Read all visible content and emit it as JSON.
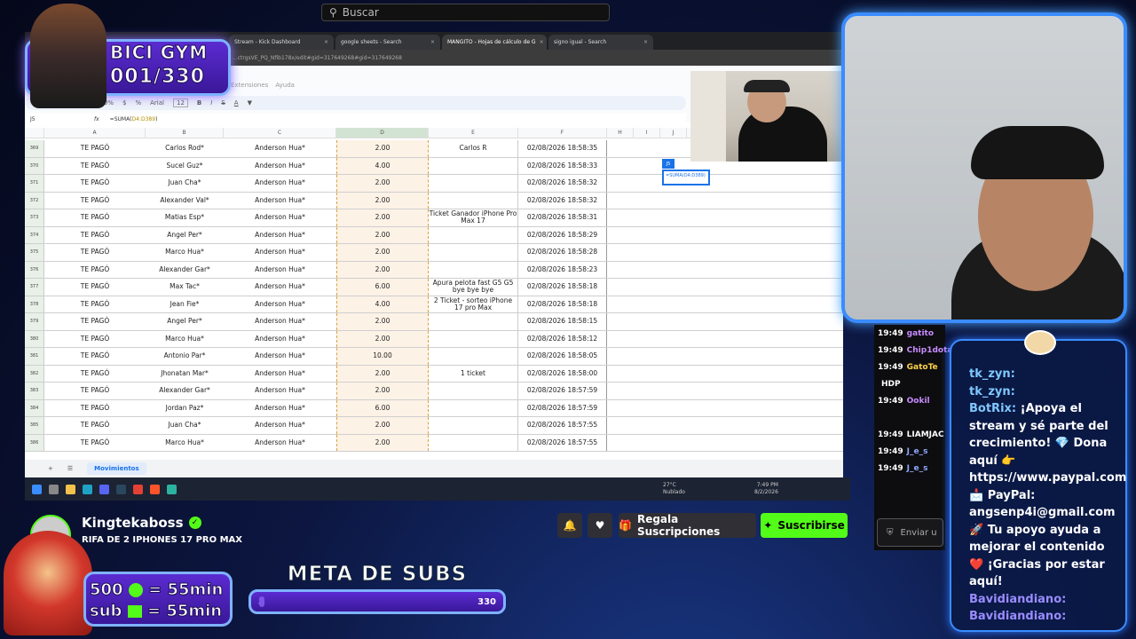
{
  "search": {
    "placeholder": "Buscar"
  },
  "browser": {
    "tabs": [
      {
        "label": "Stream - Kick Dashboard",
        "active": false
      },
      {
        "label": "google sheets - Search",
        "active": false
      },
      {
        "label": "MANGITO - Hojas de cálculo de G",
        "active": true
      },
      {
        "label": "signo igual - Search",
        "active": false
      }
    ],
    "url": "...ctrgsVE_PQ_Nfib178x/edit#gid=317649268#gid=317649268"
  },
  "sheet": {
    "menu": [
      "Extensiones",
      "Ayuda"
    ],
    "toolbar": {
      "zoom": "100%",
      "font": "Arial",
      "size": "12"
    },
    "cell_ref": "J5",
    "formula": "=SUMA(D4:D389)",
    "formula_fn": "=SUMA(",
    "formula_range": "D4:D389",
    "formula_close": ")",
    "columns": [
      "A",
      "B",
      "C",
      "D",
      "E",
      "F",
      "H",
      "I",
      "J"
    ],
    "rows": [
      {
        "n": "369",
        "a": "TE PAGÓ",
        "b": "Carlos Rod*",
        "c": "Anderson Hua*",
        "d": "2.00",
        "e": "Carlos R",
        "f": "02/08/2026 18:58:35"
      },
      {
        "n": "370",
        "a": "TE PAGÓ",
        "b": "Sucel Guz*",
        "c": "Anderson Hua*",
        "d": "4.00",
        "e": "",
        "f": "02/08/2026 18:58:33"
      },
      {
        "n": "371",
        "a": "TE PAGÓ",
        "b": "Juan Cha*",
        "c": "Anderson Hua*",
        "d": "2.00",
        "e": "",
        "f": "02/08/2026 18:58:32"
      },
      {
        "n": "372",
        "a": "TE PAGÓ",
        "b": "Alexander Val*",
        "c": "Anderson Hua*",
        "d": "2.00",
        "e": "",
        "f": "02/08/2026 18:58:32"
      },
      {
        "n": "373",
        "a": "TE PAGÓ",
        "b": "Matias Esp*",
        "c": "Anderson Hua*",
        "d": "2.00",
        "e": "Ticket Ganador iPhone Pro Max 17",
        "f": "02/08/2026 18:58:31"
      },
      {
        "n": "374",
        "a": "TE PAGÓ",
        "b": "Angel Per*",
        "c": "Anderson Hua*",
        "d": "2.00",
        "e": "",
        "f": "02/08/2026 18:58:29"
      },
      {
        "n": "375",
        "a": "TE PAGÓ",
        "b": "Marco Hua*",
        "c": "Anderson Hua*",
        "d": "2.00",
        "e": "",
        "f": "02/08/2026 18:58:28"
      },
      {
        "n": "376",
        "a": "TE PAGÓ",
        "b": "Alexander Gar*",
        "c": "Anderson Hua*",
        "d": "2.00",
        "e": "",
        "f": "02/08/2026 18:58:23"
      },
      {
        "n": "377",
        "a": "TE PAGÓ",
        "b": "Max Tac*",
        "c": "Anderson Hua*",
        "d": "6.00",
        "e": "Apura pelota fast G5 G5 bye bye bye",
        "f": "02/08/2026 18:58:18"
      },
      {
        "n": "378",
        "a": "TE PAGÓ",
        "b": "Jean Fie*",
        "c": "Anderson Hua*",
        "d": "4.00",
        "e": "2 Ticket - sorteo iPhone 17 pro Max",
        "f": "02/08/2026 18:58:18"
      },
      {
        "n": "379",
        "a": "TE PAGÓ",
        "b": "Angel Per*",
        "c": "Anderson Hua*",
        "d": "2.00",
        "e": "",
        "f": "02/08/2026 18:58:15"
      },
      {
        "n": "380",
        "a": "TE PAGÓ",
        "b": "Marco Hua*",
        "c": "Anderson Hua*",
        "d": "2.00",
        "e": "",
        "f": "02/08/2026 18:58:12"
      },
      {
        "n": "381",
        "a": "TE PAGÓ",
        "b": "Antonio Par*",
        "c": "Anderson Hua*",
        "d": "10.00",
        "e": "",
        "f": "02/08/2026 18:58:05"
      },
      {
        "n": "382",
        "a": "TE PAGÓ",
        "b": "Jhonatan Mar*",
        "c": "Anderson Hua*",
        "d": "2.00",
        "e": "1 ticket",
        "f": "02/08/2026 18:58:00"
      },
      {
        "n": "383",
        "a": "TE PAGÓ",
        "b": "Alexander Gar*",
        "c": "Anderson Hua*",
        "d": "2.00",
        "e": "",
        "f": "02/08/2026 18:57:59"
      },
      {
        "n": "384",
        "a": "TE PAGÓ",
        "b": "Jordan Paz*",
        "c": "Anderson Hua*",
        "d": "6.00",
        "e": "",
        "f": "02/08/2026 18:57:59"
      },
      {
        "n": "385",
        "a": "TE PAGÓ",
        "b": "Juan Cha*",
        "c": "Anderson Hua*",
        "d": "2.00",
        "e": "",
        "f": "02/08/2026 18:57:55"
      },
      {
        "n": "386",
        "a": "TE PAGÓ",
        "b": "Marco Hua*",
        "c": "Anderson Hua*",
        "d": "2.00",
        "e": "",
        "f": "02/08/2026 18:57:55"
      }
    ],
    "sheet_tab": "Movimientos",
    "selected_badge": "J5"
  },
  "taskbar": {
    "weather_temp": "27°C",
    "weather_desc": "Nublado",
    "time": "7:49 PM",
    "date": "8/2/2026"
  },
  "overlay": {
    "gym_title": "BICI GYM",
    "gym_count": "001/330",
    "subs_line1": "500",
    "subs_line1_suffix": "= 55min",
    "subs_line2": "sub",
    "subs_line2_suffix": "= 55min",
    "meta_title": "META DE SUBS",
    "meta_current": "5",
    "meta_goal": "330",
    "meta_fraction": 0.015
  },
  "chat_left": [
    {
      "time": "19:49",
      "user": "gatito",
      "color": "#c98bff"
    },
    {
      "time": "19:49",
      "user": "Chip1dota",
      "color": "#c98bff"
    },
    {
      "time": "19:49",
      "user": "GatoTe",
      "color": "#ffd24a"
    },
    {
      "time": "",
      "user": "HDP",
      "color": "#ffffff"
    },
    {
      "time": "19:49",
      "user": "Ookil",
      "color": "#c98bff"
    },
    {
      "time": "",
      "user": "",
      "color": "#ffffff"
    },
    {
      "time": "19:49",
      "user": "LIAMJAC",
      "color": "#ffffff"
    },
    {
      "time": "19:49",
      "user": "J_e_s",
      "color": "#8fa8ff"
    },
    {
      "time": "19:49",
      "user": "J_e_s",
      "color": "#8fa8ff"
    }
  ],
  "chat_input": {
    "placeholder": "Enviar u"
  },
  "chat_panel": {
    "lines": [
      {
        "user": "tk_zyn:",
        "text": "",
        "cls": "user"
      },
      {
        "user": "tk_zyn:",
        "text": "",
        "cls": "user"
      },
      {
        "user": "BotRix:",
        "text": "¡Apoya el stream y sé parte del crecimiento! 💎 Dona aquí 👉 https://www.paypal.com 📩 PayPal: angsenp4i@gmail.com 🚀 Tu apoyo ayuda a mejorar el contenido ❤️ ¡Gracias por estar aquí!",
        "cls": "user"
      },
      {
        "user": "Bavidiandiano:",
        "text": "",
        "cls": "user2"
      },
      {
        "user": "Bavidiandiano:",
        "text": "",
        "cls": "user2"
      }
    ]
  },
  "channel": {
    "name": "Kingtekaboss",
    "title": "RIFA DE 2 IPHONES 17 PRO MAX",
    "gift_label": "Regala Suscripciones",
    "subscribe_label": "Suscribirse"
  },
  "colors": {
    "kick_green": "#53fc18",
    "overlay_purple": "#5b2bd1",
    "overlay_border": "#7fb2ff",
    "sheet_select": "#1a73e8"
  }
}
